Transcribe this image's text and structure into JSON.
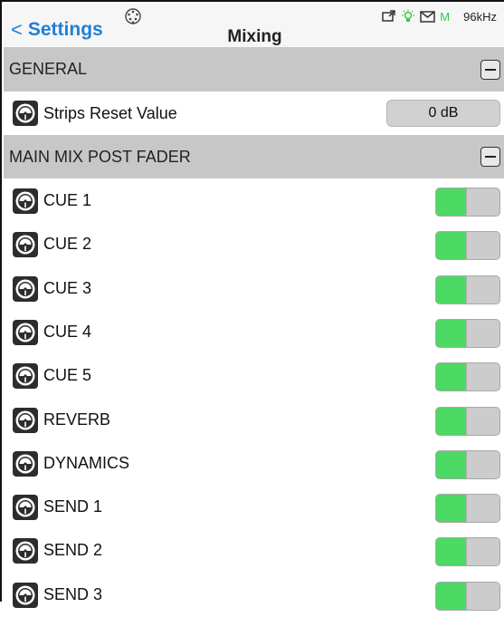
{
  "header": {
    "back_chevron": "<",
    "back_label": "Settings",
    "title": "Mixing",
    "status": {
      "midi_icon": "midi-connector-icon",
      "icons": [
        "display-icon",
        "bulb-icon",
        "envelope-icon"
      ],
      "m_label": "M",
      "sample_rate": "96kHz"
    }
  },
  "colors": {
    "accent": "#1f7fd6",
    "section_bg": "#c7c7c7",
    "toggle_on": "#4cd964",
    "toggle_off": "#cfcfcf"
  },
  "general": {
    "label": "GENERAL",
    "strips_reset": {
      "label": "Strips Reset Value",
      "value": "0 dB"
    }
  },
  "main_mix": {
    "label": "MAIN MIX POST FADER",
    "items": [
      {
        "label": "CUE 1",
        "on": true
      },
      {
        "label": "CUE 2",
        "on": true
      },
      {
        "label": "CUE 3",
        "on": true
      },
      {
        "label": "CUE 4",
        "on": true
      },
      {
        "label": "CUE 5",
        "on": true
      },
      {
        "label": "REVERB",
        "on": true
      },
      {
        "label": "DYNAMICS",
        "on": true
      },
      {
        "label": "SEND 1",
        "on": true
      },
      {
        "label": "SEND 2",
        "on": true
      },
      {
        "label": "SEND 3",
        "on": true
      }
    ]
  }
}
